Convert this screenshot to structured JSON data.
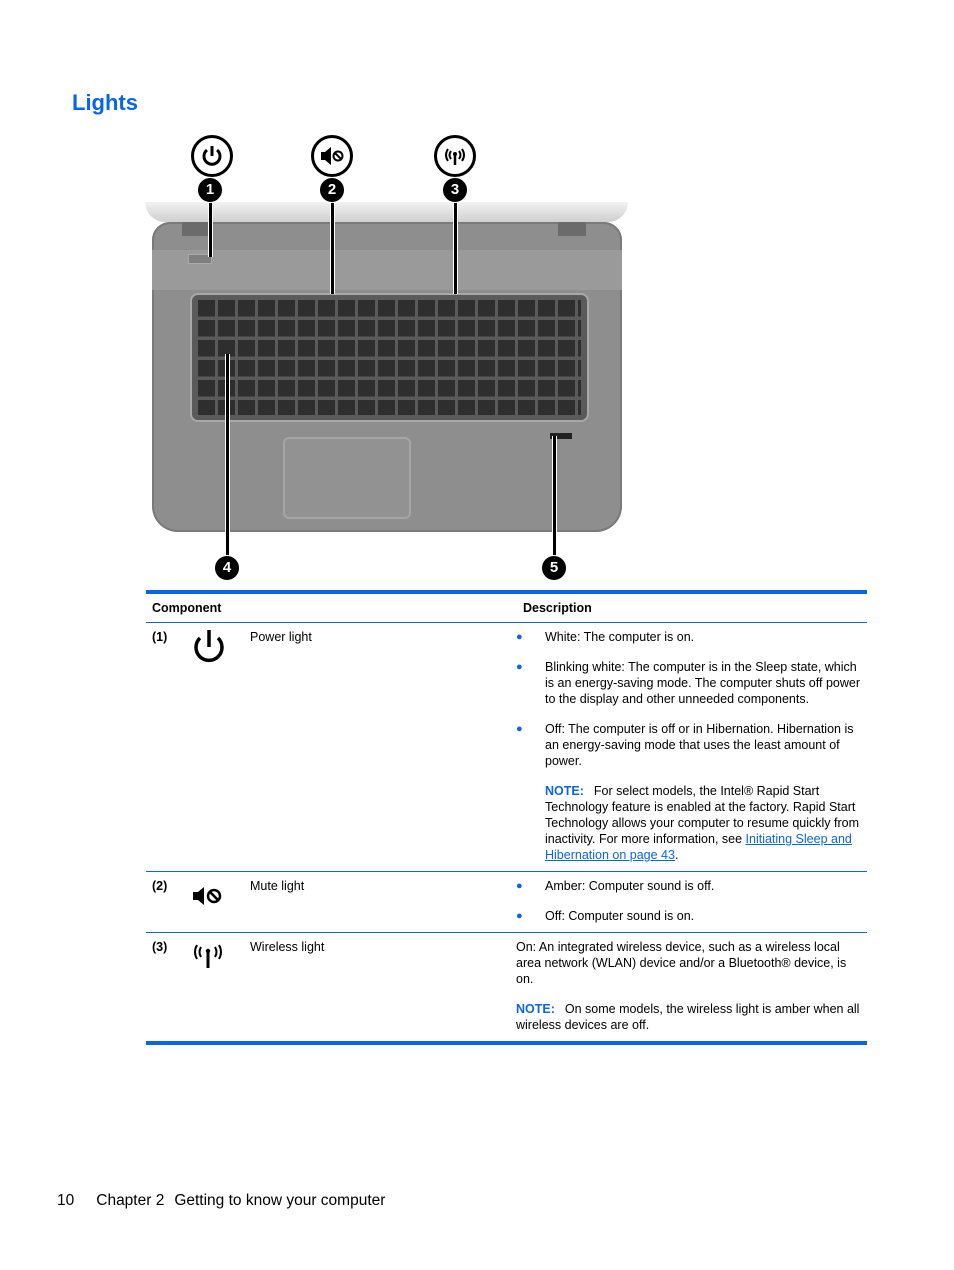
{
  "page": {
    "title": "Lights",
    "accent_color": "#0a66e6"
  },
  "figure": {
    "callouts": [
      {
        "number": "1",
        "icon": "power-icon"
      },
      {
        "number": "2",
        "icon": "mute-icon"
      },
      {
        "number": "3",
        "icon": "wireless-icon"
      },
      {
        "number": "4"
      },
      {
        "number": "5"
      }
    ]
  },
  "table": {
    "headers": {
      "component": "Component",
      "description": "Description"
    },
    "rows": [
      {
        "number": "(1)",
        "icon": "power-icon",
        "name": "Power light",
        "bullets": [
          "White: The computer is on.",
          "Blinking white: The computer is in the Sleep state, which is an energy-saving mode. The computer shuts off power to the display and other unneeded components.",
          "Off: The computer is off or in Hibernation. Hibernation is an energy-saving mode that uses the least amount of power."
        ],
        "note_label": "NOTE:",
        "note_text": "For select models, the Intel® Rapid Start Technology feature is enabled at the factory. Rapid Start Technology allows your computer to resume quickly from inactivity. For more information, see ",
        "note_link": "Initiating Sleep and Hibernation on page 43",
        "note_end": "."
      },
      {
        "number": "(2)",
        "icon": "mute-icon",
        "name": "Mute light",
        "bullets": [
          "Amber: Computer sound is off.",
          "Off: Computer sound is on."
        ]
      },
      {
        "number": "(3)",
        "icon": "wireless-icon",
        "name": "Wireless light",
        "text": "On: An integrated wireless device, such as a wireless local area network (WLAN) device and/or a Bluetooth® device, is on.",
        "note_label": "NOTE:",
        "note_text": "On some models, the wireless light is amber when all wireless devices are off."
      }
    ]
  },
  "footer": {
    "page_number": "10",
    "chapter": "Chapter 2",
    "chapter_title": "Getting to know your computer"
  }
}
